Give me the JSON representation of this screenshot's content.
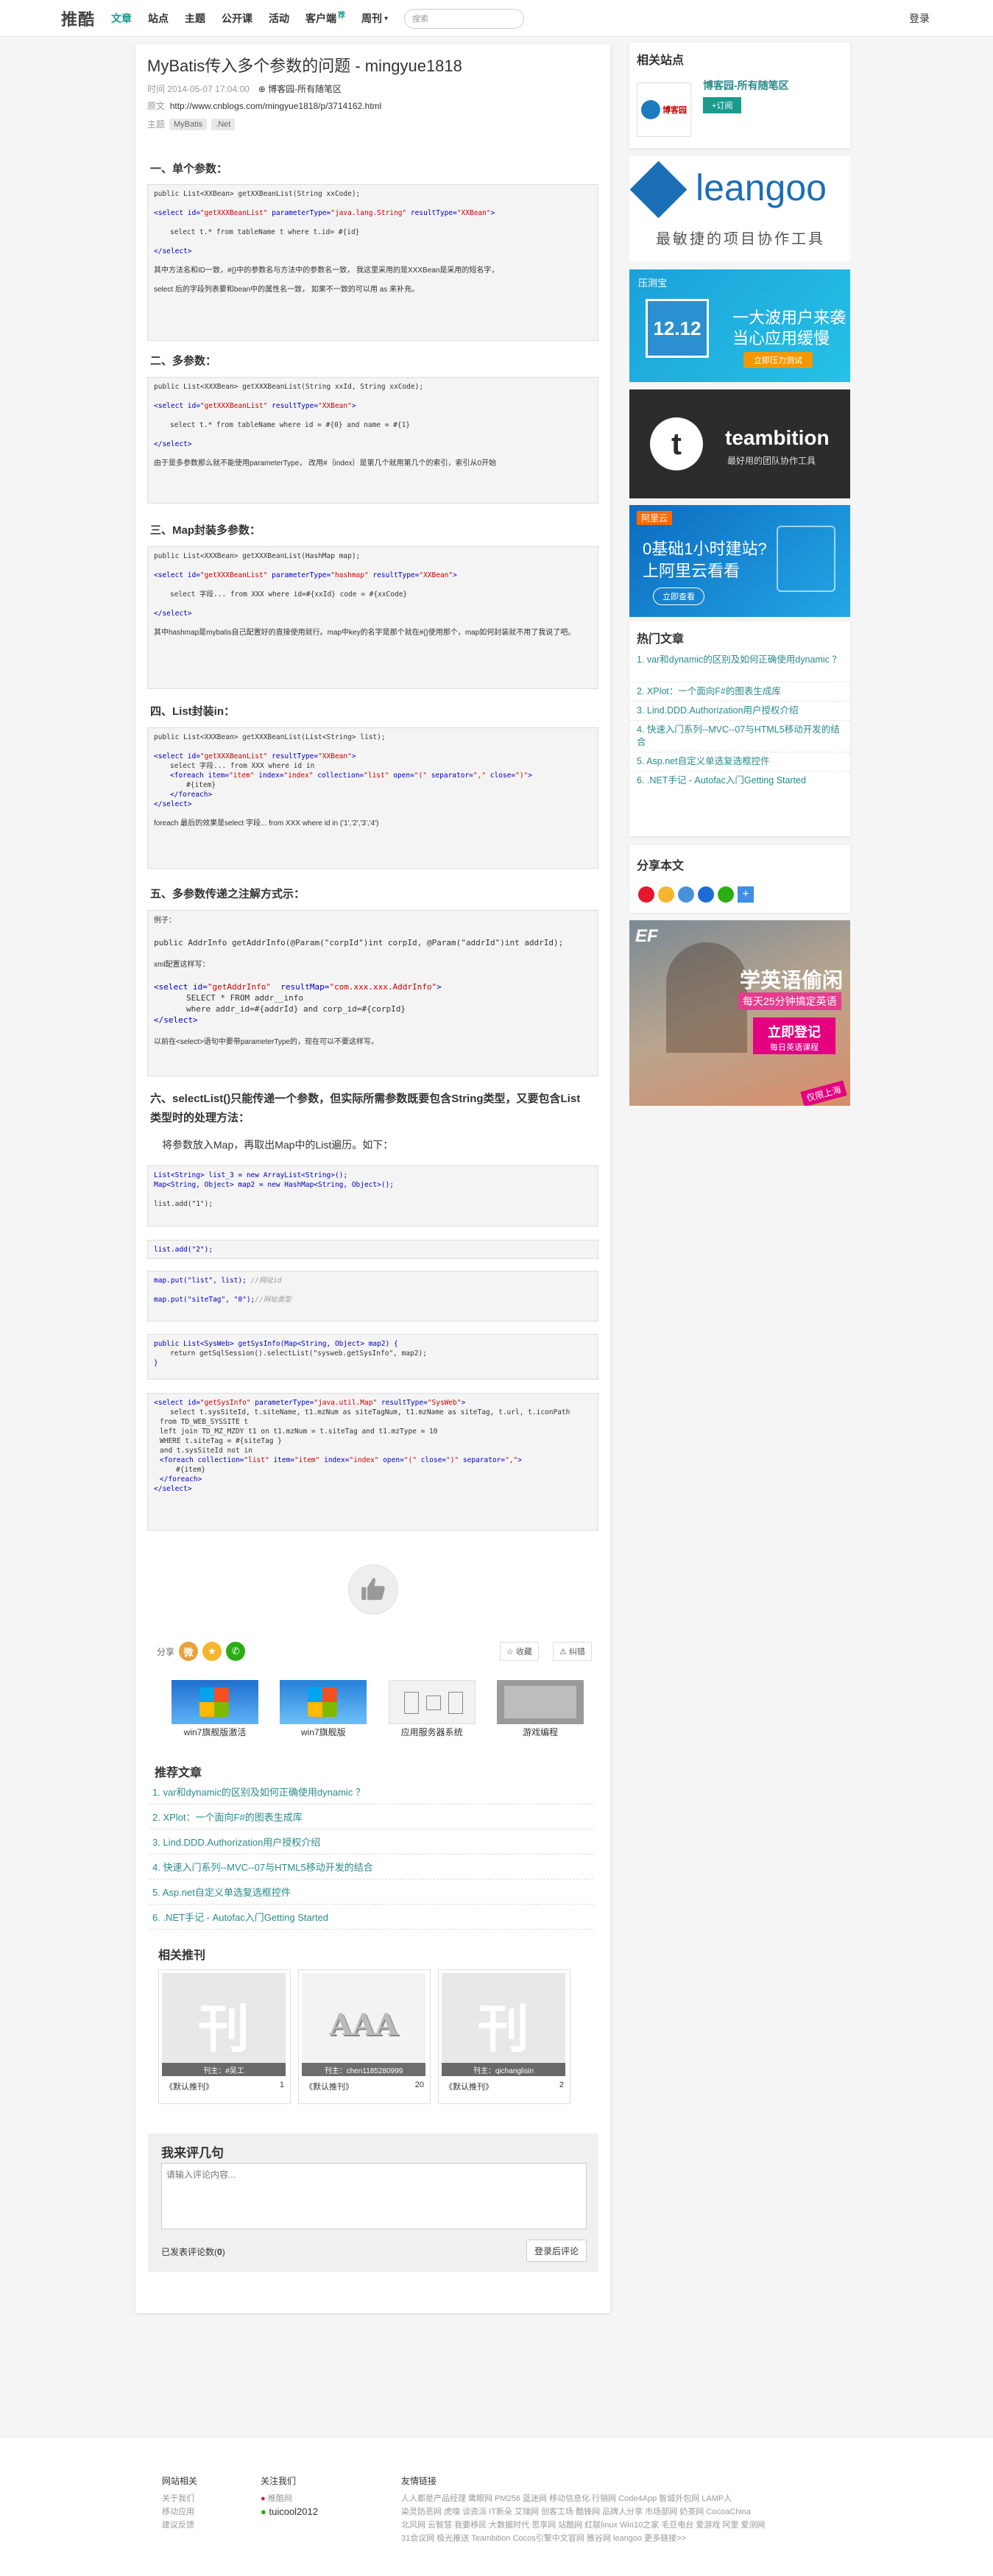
{
  "topnav": {
    "logo": "推酷",
    "items": [
      "文章",
      "站点",
      "主题",
      "公开课",
      "活动",
      "客户端",
      "周刊"
    ],
    "badge": "荐",
    "search_placeholder": "搜索",
    "login": "登录"
  },
  "article": {
    "title": "MyBatis传入多个参数的问题 - mingyue1818",
    "time_label": "时间",
    "time": "2014-05-07 17:04:00",
    "site": "博客园-所有随笔区",
    "source_label": "原文",
    "source_url": "http://www.cnblogs.com/mingyue1818/p/3714162.html",
    "topic_label": "主题",
    "tags": [
      "MyBatis",
      ".Net"
    ],
    "h1": "一、单个参数：",
    "h2": "二、多参数：",
    "h3": "三、Map封装多参数：",
    "h4": "四、List封装in：",
    "h5": "五、多参数传递之注解方式示：",
    "h6": "六、selectList()只能传递一个参数，但实际所需参数既要包含String类型，又要包含List类型时的处理方法：",
    "p6": "将参数放入Map，再取出Map中的List遍历。如下：",
    "code1": {
      "l1": "public List<XXBean> getXXBeanList(String xxCode);",
      "l2a": "<select id=",
      "l2b": "\"getXXXBeanList\"",
      "l2c": " parameterType=",
      "l2d": "\"java.lang.String\"",
      "l2e": " resultType=",
      "l2f": "\"XXBean\"",
      "l2g": ">",
      "l3": "select t.* from tableName t where t.id= #{id}",
      "l4": "</select>",
      "t1": "其中方法名和ID一致，#{}中的参数名与方法中的参数名一致， 我这里采用的是XXXBean是采用的短名字，",
      "t2": "select 后的字段列表要和bean中的属性名一致， 如果不一致的可以用 as 来补充。"
    },
    "code2": {
      "l1": "public List<XXXBean> getXXXBeanList(String xxId, String xxCode);",
      "l2a": "<select id=",
      "l2b": "\"getXXXBeanList\"",
      "l2c": " resultType=",
      "l2d": "\"XXBean\"",
      "l2e": ">",
      "l3": "select t.* from tableName where id = #{0} and name = #{1}",
      "l4": "</select>",
      "t1": "由于是多参数那么就不能使用parameterType， 改用#｛index｝是第几个就用第几个的索引，索引从0开始"
    },
    "code3": {
      "l1": "public List<XXXBean> getXXXBeanList(HashMap map);",
      "l2a": "<select id=",
      "l2b": "\"getXXXBeanList\"",
      "l2c": " parameterType=",
      "l2d": "\"hashmap\"",
      "l2e": " resultType=",
      "l2f": "\"XXBean\"",
      "l2g": ">",
      "l3": "select 字段... from XXX where id=#{xxId} code = #{xxCode}",
      "l4": "</select>",
      "t1": "其中hashmap是mybatis自己配置好的直接使用就行。map中key的名字是那个就在#{}使用那个，map如何封装就不用了我说了吧。"
    },
    "code4": {
      "l1": "public List<XXXBean> getXXXBeanList(List<String> list);",
      "l2a": "<select id=",
      "l2b": "\"getXXXBeanList\"",
      "l2c": " resultType=",
      "l2d": "\"XXBean\"",
      "l2e": ">",
      "l3": "select 字段... from XXX where id in",
      "l4a": "<foreach item=",
      "l4b": "\"item\"",
      "l4c": " index=",
      "l4d": "\"index\"",
      "l4e": " collection=",
      "l4f": "\"list\"",
      "l4g": " open=",
      "l4h": "\"(\"",
      "l4i": " separator=",
      "l4j": "\",\"",
      "l4k": " close=",
      "l4l": "\")\"",
      "l4m": ">",
      "l5": "#{item}",
      "l6": "</foreach>",
      "l7": "</select>",
      "t1": "foreach 最后的效果是select 字段... from XXX where id in ('1','2','3','4')"
    },
    "code5": {
      "t0": "例子：",
      "l1": "public AddrInfo getAddrInfo(@Param(\"corpId\")int corpId, @Param(\"addrId\")int addrId);",
      "t1": "xml配置这样写：",
      "l2a": "<select id=",
      "l2b": "\"getAddrInfo\"",
      "l2c": "  resultMap=",
      "l2d": "\"com.xxx.xxx.AddrInfo\"",
      "l2e": ">",
      "l3": "SELECT * FROM addr__info",
      "l4": "where addr_id=#{addrId} and corp_id=#{corpId}",
      "l5": "</select>",
      "t2": "以前在<select>语句中要带parameterType的，现在可以不要这样写。"
    },
    "code6": {
      "l1": "List<String> list_3 = new ArrayList<String>();",
      "l2": "Map<String, Object> map2 = new HashMap<String, Object>();",
      "l3": "list.add(\"1\");"
    },
    "code7": {
      "l1": "list.add(\"2\");"
    },
    "code8": {
      "l1": "map.put(\"list\", list); ",
      "l1c": "//网址id",
      "l2": "map.put(\"siteTag\", \"0\");",
      "l2c": "//网址类型"
    },
    "code9": {
      "l1": "public List<SysWeb> getSysInfo(Map<String, Object> map2) {",
      "l2": "return getSqlSession().selectList(\"sysweb.getSysInfo\", map2);",
      "l3": "}"
    },
    "code10": {
      "l1a": "<select id=",
      "l1b": "\"getSysInfo\"",
      "l1c": " parameterType=",
      "l1d": "\"java.util.Map\"",
      "l1e": " resultType=",
      "l1f": "\"SysWeb\"",
      "l1g": ">",
      "l2": "select t.sysSiteId, t.siteName, t1.mzNum as siteTagNum, t1.mzName as siteTag, t.url, t.iconPath",
      "l3": "from TD_WEB_SYSSITE t",
      "l4": "left join TD_MZ_MZDY t1 on t1.mzNum = t.siteTag and t1.mzType = 10",
      "l5": "WHERE t.siteTag = #{siteTag }",
      "l6": "and t.sysSiteId not in",
      "l7a": "<foreach collection=",
      "l7b": "\"list\"",
      "l7c": " item=",
      "l7d": "\"item\"",
      "l7e": " index=",
      "l7f": "\"index\"",
      "l7g": " open=",
      "l7h": "\"(\"",
      "l7i": " close=",
      "l7j": "\")\"",
      "l7k": " separator=",
      "l7l": "\",\"",
      "l7m": ">",
      "l8": "#{item}",
      "l9": "</foreach>",
      "l10": "</select>"
    }
  },
  "share": {
    "label": "分享",
    "collect": "收藏",
    "report": "纠错"
  },
  "thumbs": [
    "win7旗舰版激活",
    "win7旗舰版",
    "应用服务器系统",
    "游戏编程"
  ],
  "recommend": {
    "title": "推荐文章",
    "items": [
      "1. var和dynamic的区别及如何正确使用dynamic ？",
      "2. XPlot：一个面向F#的图表生成库",
      "3. Lind.DDD.Authorization用户授权介绍",
      "4. 快速入门系列--MVC--07与HTML5移动开发的结合",
      "5. Asp.net自定义单选复选框控件",
      "6. .NET手记 - Autofac入门Getting Started"
    ]
  },
  "mags": {
    "title": "相关推刊",
    "items": [
      {
        "owner": "刊主：#吴工",
        "name": "《默认推刊》",
        "count": "1",
        "glyph": "刊"
      },
      {
        "owner": "刊主：chen1185280999",
        "name": "《默认推刊》",
        "count": "20",
        "glyph": "AAA"
      },
      {
        "owner": "刊主：qichanglisin",
        "name": "《默认推刊》",
        "count": "2",
        "glyph": "刊"
      }
    ]
  },
  "comment": {
    "title": "我来评几句",
    "placeholder": "请输入评论内容...",
    "count_label": "已发表评论数(",
    "count": "0",
    "count_end": ")",
    "submit": "登录后评论"
  },
  "sidebar": {
    "related_title": "相关站点",
    "site_name": "博客园-所有随笔区",
    "subscribe": "+订阅",
    "site_logo": "博客园",
    "ad1": {
      "brand": "leangoo",
      "slogan": "最敏捷的项目协作工具"
    },
    "ad2": {
      "brand": "压测宝",
      "date": "12.12",
      "line1": "一大波用户来袭",
      "line2": "当心应用缓慢",
      "btn": "立即压力测试"
    },
    "ad3": {
      "brand": "teambition",
      "sub": "最好用的团队协作工具"
    },
    "ad4": {
      "brand": "阿里云",
      "line1": "0基础1小时建站?",
      "line2": "上阿里云看看",
      "btn": "立即查看"
    },
    "hot_title": "热门文章",
    "hot": [
      "1. var和dynamic的区别及如何正确使用dynamic ？",
      "2. XPlot：一个面向F#的图表生成库",
      "3. Lind.DDD.Authorization用户授权介绍",
      "4. 快速入门系列--MVC--07与HTML5移动开发的结合",
      "5. Asp.net自定义单选复选框控件",
      "6. .NET手记 - Autofac入门Getting Started"
    ],
    "share_title": "分享本文",
    "ad5": {
      "brand": "EF",
      "line1": "学英语偷闲",
      "line2": "每天25分钟搞定英语",
      "btn1": "立即登记",
      "btn2": "每日英语课程",
      "corner": "仅限上海"
    }
  },
  "footer": {
    "col1": {
      "title": "网站相关",
      "items": [
        "关于我们",
        "移动应用",
        "建议反馈"
      ]
    },
    "col2": {
      "title": "关注我们",
      "items": [
        "推酷网",
        "tuicool2012"
      ]
    },
    "col3": {
      "title": "友情链接",
      "lines": [
        "人人都是产品经理  鹰眼网  PM256  蓝迷网  移动信息化  行销网  Code4App  智城外包网  LAMP人",
        "染灵防恶网  虎嗅  谈资派  IT新朵  艾瑞网  创客工场  酷锋网  品牌人分享  市场部网  奶茶网  CocoaChina",
        "北风网  云智慧  我要移民  大数据时代  思享网  站酷网  红联linux  Win10之家  毛豆电台  爱游戏  阿里  爱测网",
        "31会议网  极光推送  Teambition  Cocos引擎中文官网  雅谷网  leangoo  更多链接>>"
      ]
    }
  },
  "colors": {
    "accent": "#1a9b8c",
    "link": "#2a8a8a",
    "kw": "#0000c0",
    "str": "#cc0000"
  }
}
